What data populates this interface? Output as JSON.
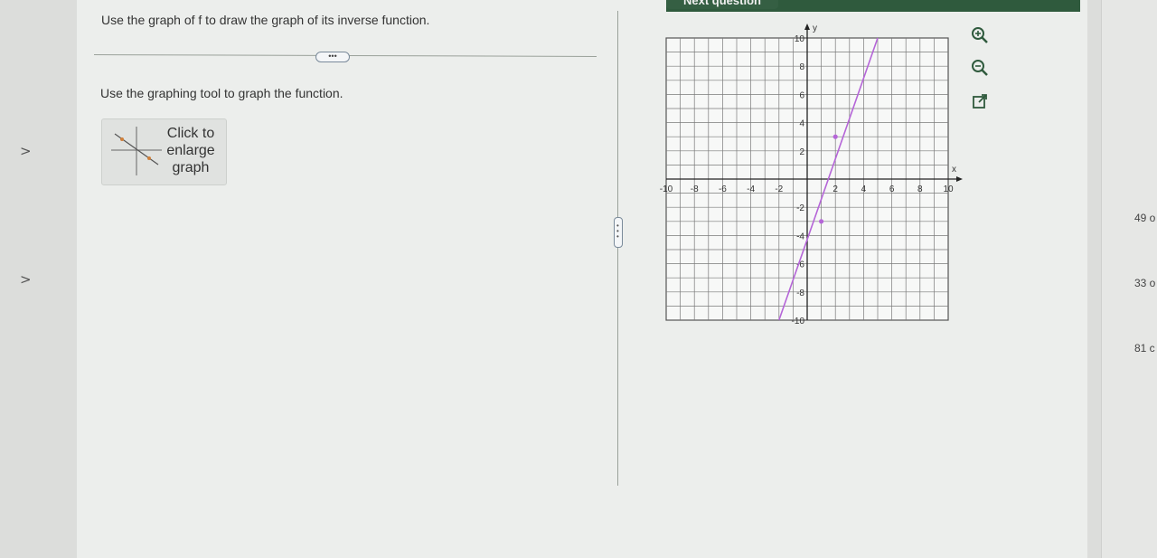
{
  "nav": {
    "chevrons": [
      ">",
      ">"
    ]
  },
  "header": {
    "next_button_label": "Next question"
  },
  "question": {
    "prompt": "Use the graph of f to draw the graph of its inverse function.",
    "more_label": "•••",
    "instruction": "Use the graphing tool to graph the function.",
    "enlarge_label": "Click to enlarge graph"
  },
  "graph": {
    "x_label": "x",
    "y_label": "y",
    "x_ticks": [
      "-10",
      "-8",
      "-6",
      "-4",
      "-2",
      "2",
      "4",
      "6",
      "8",
      "10"
    ],
    "y_ticks": [
      "10",
      "8",
      "6",
      "4",
      "2",
      "-2",
      "-4",
      "-6",
      "-8",
      "-10"
    ],
    "xlim": [
      -10,
      10
    ],
    "ylim": [
      -10,
      10
    ],
    "line_color": "#b565d8",
    "line_points": [
      [
        -2,
        -10
      ],
      [
        5,
        10
      ]
    ],
    "marked_points": [
      [
        1,
        -3
      ],
      [
        2,
        3
      ]
    ]
  },
  "tools": {
    "zoom_in": "zoom-in-icon",
    "zoom_out": "zoom-out-icon",
    "popout": "external-link-icon"
  },
  "scores": [
    "49 o",
    "33 o",
    "81 c"
  ],
  "colors": {
    "accent": "#2f5a3d",
    "graph_line": "#b565d8"
  }
}
